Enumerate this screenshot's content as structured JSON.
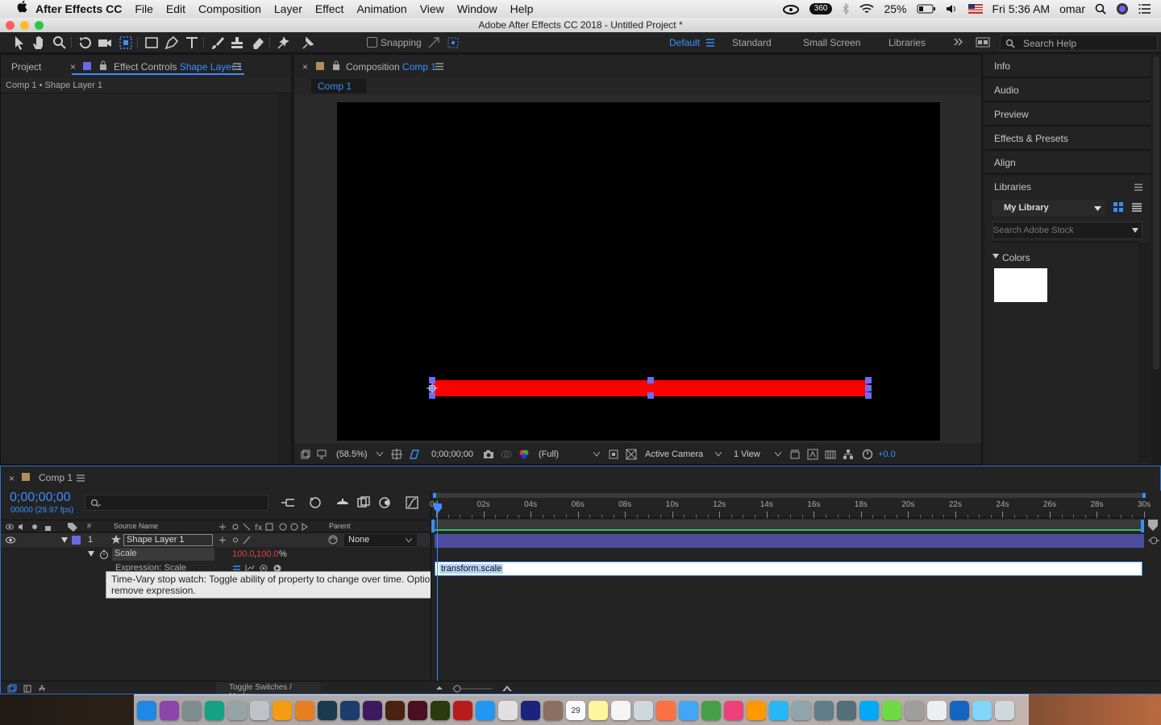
{
  "menubar": {
    "apple": "",
    "items": [
      "After Effects CC",
      "File",
      "Edit",
      "Composition",
      "Layer",
      "Effect",
      "Animation",
      "View",
      "Window",
      "Help"
    ],
    "battery": "25%",
    "clock": "Fri 5:36 AM",
    "user": "omar",
    "badge_360": "360"
  },
  "window": {
    "title": "Adobe After Effects CC 2018 - Untitled Project *"
  },
  "toolbar": {
    "snapping": "Snapping",
    "workspaces": [
      "Default",
      "Standard",
      "Small Screen",
      "Libraries"
    ],
    "search_placeholder": "Search Help"
  },
  "left_panel": {
    "tab_project": "Project",
    "tab_effect_controls": "Effect Controls",
    "tab_effect_layer": "Shape Layer 1",
    "breadcrumb": "Comp 1 • Shape Layer 1"
  },
  "comp_panel": {
    "tab_label": "Composition",
    "tab_comp": "Comp 1",
    "subtab": "Comp 1",
    "bar_color": "#ff0000",
    "zoom": "(58.5%)",
    "timecode": "0;00;00;00",
    "resolution": "(Full)",
    "camera": "Active Camera",
    "views": "1 View",
    "exposure": "+0.0"
  },
  "right_panel": {
    "items": [
      "Info",
      "Audio",
      "Preview",
      "Effects & Presets",
      "Align"
    ],
    "libraries_title": "Libraries",
    "library_select": "My Library",
    "stock_placeholder": "Search Adobe Stock",
    "colors_label": "Colors",
    "swatch_color": "#ffffff"
  },
  "timeline": {
    "tab": "Comp 1",
    "timecode": "0;00;00;00",
    "frames": "00000 (29.97 fps)",
    "col_hash": "#",
    "col_source": "Source Name",
    "col_parent": "Parent",
    "layer_num": "1",
    "layer_name": "Shape Layer 1",
    "parent_value": "None",
    "prop_name": "Scale",
    "prop_value_1": "100.0",
    "prop_value_2": "100.0",
    "prop_unit": "%",
    "expression_label": "Expression: Scale",
    "expression_text": "transform.scale",
    "tooltip": "Time-Vary stop watch: Toggle ability of property to change over time. Option-click: add or remove expression.",
    "ruler": [
      "0s",
      "02s",
      "04s",
      "06s",
      "08s",
      "10s",
      "12s",
      "14s",
      "16s",
      "18s",
      "20s",
      "22s",
      "24s",
      "26s",
      "28s",
      "30s"
    ],
    "toggle_label": "Toggle Switches / Modes"
  },
  "dock": {
    "apps": [
      "finder-icon",
      "siri-icon",
      "launchpad-icon",
      "maya-icon",
      "ik-icon",
      "help-icon",
      "app-a-icon",
      "app-b-icon",
      "lightroom-icon",
      "photoshop-icon",
      "after-effects-icon",
      "illustrator-icon",
      "indesign-icon",
      "muse-icon",
      "acrobat-icon",
      "safari-icon",
      "chrome-icon",
      "quicktime-icon",
      "notes-brown-icon",
      "calendar-icon",
      "notes-icon",
      "reminders-icon",
      "preview-icon",
      "photos-icon",
      "messages-icon",
      "facetime-icon",
      "itunes-icon",
      "ibooks-icon",
      "appstore-icon",
      "prefs-icon",
      "monitor-icon",
      "diskutil-icon",
      "skype-icon",
      "upwork-icon",
      "server-icon",
      "archive-icon",
      "w-icon",
      "folder-icon",
      "trash-icon"
    ],
    "calendar_day": "29"
  }
}
